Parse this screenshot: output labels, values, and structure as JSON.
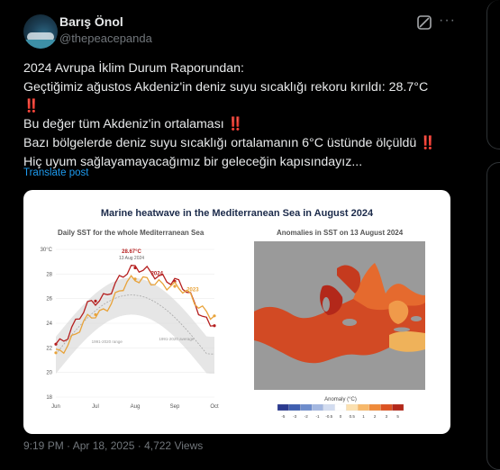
{
  "author": {
    "name": "Barış Önol",
    "handle": "@thepeacepanda"
  },
  "icons": {
    "grok": "grok-icon",
    "more": "more-icon"
  },
  "tweet": {
    "line1": "2024 Avrupa İklim Durum Raporundan:",
    "line2": "Geçtiğimiz ağustos Akdeniz'in deniz suyu sıcaklığı  rekoru kırıldı: 28.7°C",
    "line3": "‼️",
    "line4": "Bu değer tüm Akdeniz'in ortalaması",
    "line4_mark": "‼️",
    "line5": "Bazı bölgelerde deniz suyu sıcaklığı ortalamanın 6°C üstünde ölçüldü",
    "line5_mark": "‼️",
    "line6": "Hiç uyum sağlayamayacağımız bir geleceğin kapısındayız..."
  },
  "translate_label": "Translate post",
  "figure": {
    "title": "Marine heatwave in the Mediterranean Sea in August 2024",
    "panel1_title": "Daily SST for the whole Mediterranean Sea",
    "panel2_title": "Anomalies in SST on 13 August 2024",
    "peak_label": "28.67°C",
    "peak_date": "13 Aug 2024",
    "label_2024": "2024",
    "label_2023": "2023",
    "label_range1": "1991-2020 range",
    "label_range2": "1991-2020 average",
    "colorbar_label": "Anomaly (°C)",
    "colors": {
      "y2024": "#b51f1f",
      "y2023": "#e8a33a",
      "hot": "#c0392b",
      "land": "#9a9a9a"
    }
  },
  "chart_data": {
    "type": "line",
    "title": "Daily SST for the whole Mediterranean Sea",
    "xlabel": "",
    "ylabel": "",
    "ylim": [
      18,
      30
    ],
    "yticks": [
      18,
      20,
      22,
      24,
      26,
      28,
      30
    ],
    "ytick_labels": [
      "18",
      "20",
      "22",
      "24",
      "26",
      "28",
      "30°C"
    ],
    "x": [
      "Jun",
      "Jul",
      "Aug",
      "Sep",
      "Oct"
    ],
    "series": [
      {
        "name": "2024",
        "values": [
          22.3,
          25.8,
          28.5,
          27.4,
          23.8
        ]
      },
      {
        "name": "2023",
        "values": [
          21.6,
          24.7,
          27.6,
          27.0,
          24.6
        ]
      }
    ],
    "colorbar_ticks": [
      "-5",
      "-3",
      "-2",
      "-1",
      "-0.5",
      "0",
      "0.5",
      "1",
      "2",
      "3",
      "5"
    ]
  },
  "footer_text": "9:19 PM · Apr 18, 2025 · 4,722 Views"
}
